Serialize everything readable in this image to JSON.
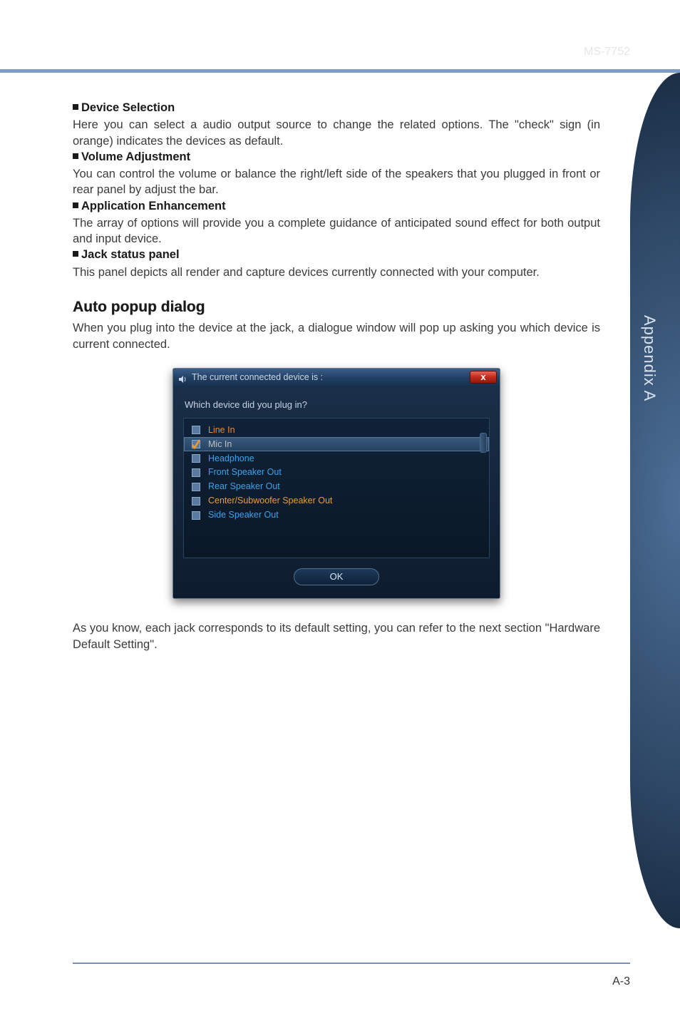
{
  "header": {
    "label": "MS-7752"
  },
  "sideTab": "Appendix A",
  "sections": {
    "device": {
      "title": "Device Selection",
      "body": "Here you can select a audio output source to change the related options. The \"check\" sign (in orange) indicates the devices as default."
    },
    "volume": {
      "title": "Volume Adjustment",
      "body": "You can control the volume or balance the right/left side of the speakers that you plugged in front or rear panel by adjust the bar."
    },
    "app": {
      "title": "Application Enhancement",
      "body": "The array of options will provide you a complete guidance of anticipated sound effect for both output and input device."
    },
    "jack": {
      "title": "Jack status panel",
      "body": "This panel depicts all render and capture devices currently connected with your computer."
    }
  },
  "autoPopup": {
    "heading": "Auto popup dialog",
    "intro": "When you plug into the device at the jack, a dialogue window will pop up asking you which device is current connected."
  },
  "dialog": {
    "title": "The current connected device is :",
    "closeGlyph": "x",
    "prompt": "Which device did you plug in?",
    "items": [
      {
        "label": "Line In",
        "cls": "c-linein",
        "fill": "#5b7aa2",
        "selected": false,
        "check": false
      },
      {
        "label": "Mic In",
        "cls": "c-micin",
        "fill": "#5b7aa2",
        "selected": true,
        "check": true
      },
      {
        "label": "Headphone",
        "cls": "c-head",
        "fill": "#5b7aa2",
        "selected": false,
        "check": false
      },
      {
        "label": "Front Speaker Out",
        "cls": "c-front",
        "fill": "#5b7aa2",
        "selected": false,
        "check": false
      },
      {
        "label": "Rear Speaker Out",
        "cls": "c-rear",
        "fill": "#5b7aa2",
        "selected": false,
        "check": false
      },
      {
        "label": "Center/Subwoofer Speaker Out",
        "cls": "c-center",
        "fill": "#5b7aa2",
        "selected": false,
        "check": false
      },
      {
        "label": "Side Speaker Out",
        "cls": "c-side",
        "fill": "#5b7aa2",
        "selected": false,
        "check": false
      }
    ],
    "ok": "OK"
  },
  "postDialog": "As you know, each jack corresponds to its default setting, you can refer to the next section \"Hardware Default Setting\".",
  "pageNum": "A-3"
}
